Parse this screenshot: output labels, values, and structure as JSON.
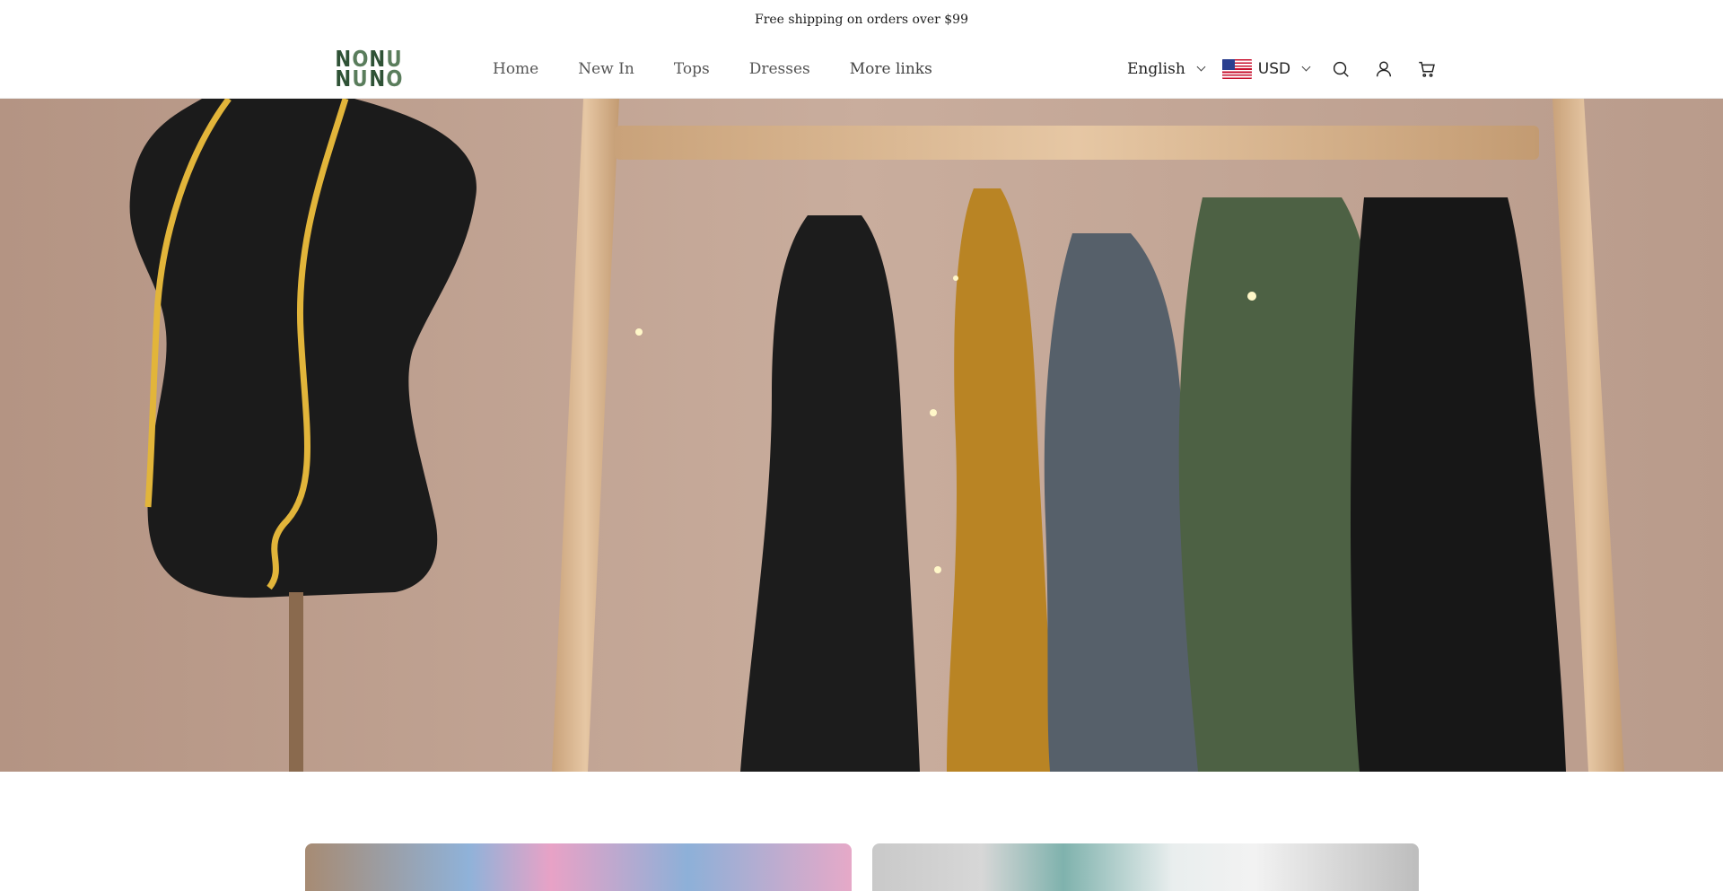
{
  "announcement": {
    "text": "Free shipping on orders over $99"
  },
  "logo": {
    "letters": [
      "N",
      "O",
      "N",
      "U",
      "N",
      "U",
      "N",
      "O"
    ],
    "color": "#2f5236"
  },
  "nav": {
    "items": [
      {
        "label": "Home"
      },
      {
        "label": "New In"
      },
      {
        "label": "Tops"
      },
      {
        "label": "Dresses"
      },
      {
        "label": "More links"
      }
    ]
  },
  "header_right": {
    "language": "English",
    "currency": "USD",
    "icons": [
      "search-icon",
      "account-icon",
      "cart-icon"
    ]
  },
  "colors": {
    "text": "#2a2a2a",
    "brand_green": "#2f5236",
    "hero_wall": "#c6a999",
    "rack_wood": "#d9b58d"
  }
}
